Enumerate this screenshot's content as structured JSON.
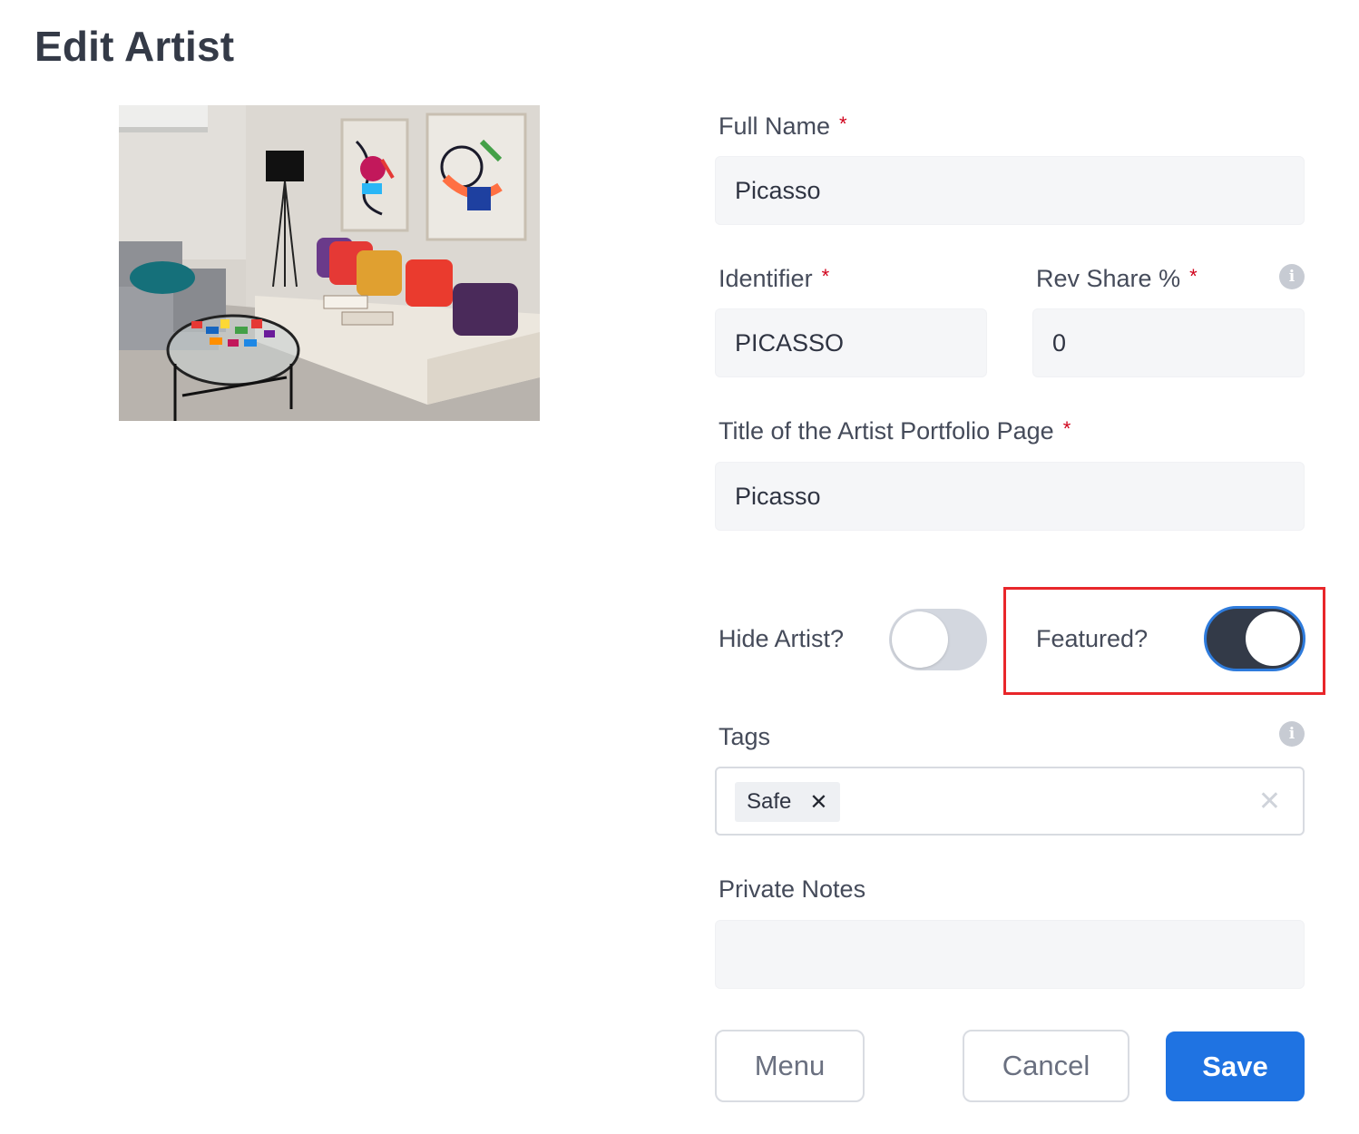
{
  "page": {
    "title": "Edit Artist"
  },
  "form": {
    "required_mark": "*",
    "full_name": {
      "label": "Full Name",
      "value": "Picasso"
    },
    "identifier": {
      "label": "Identifier",
      "value": "PICASSO"
    },
    "rev_share": {
      "label": "Rev Share %",
      "value": "0"
    },
    "portfolio_title": {
      "label": "Title of the Artist Portfolio Page",
      "value": "Picasso"
    },
    "hide_artist": {
      "label": "Hide Artist?",
      "on": false
    },
    "featured": {
      "label": "Featured?",
      "on": true
    },
    "tags": {
      "label": "Tags",
      "items": [
        "Safe"
      ],
      "remove_glyph": "✕",
      "clear_glyph": "✕"
    },
    "private_notes": {
      "label": "Private Notes",
      "value": ""
    }
  },
  "info_glyph": "i",
  "buttons": {
    "menu": "Menu",
    "cancel": "Cancel",
    "save": "Save"
  },
  "colors": {
    "primary": "#1f73e2",
    "toggle_on": "#333a48",
    "toggle_off": "#d3d7df",
    "highlight": "#e8262a",
    "required": "#d0021b"
  },
  "icons": {
    "info": "info-icon",
    "close": "close-icon"
  }
}
